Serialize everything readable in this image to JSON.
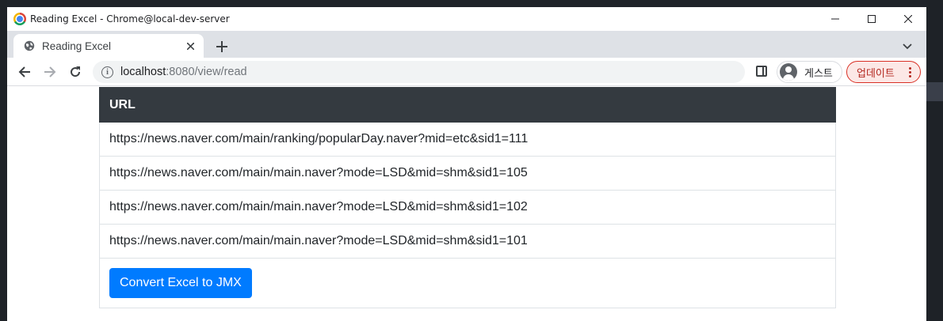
{
  "window": {
    "title": "Reading Excel - Chrome@local-dev-server"
  },
  "tabs": [
    {
      "label": "Reading Excel",
      "icon": "globe-icon"
    }
  ],
  "toolbar": {
    "url_host": "localhost",
    "url_path": ":8080/view/read",
    "profile_label": "게스트",
    "update_label": "업데이트"
  },
  "table": {
    "header": "URL",
    "rows": [
      "https://news.naver.com/main/ranking/popularDay.naver?mid=etc&sid1=111",
      "https://news.naver.com/main/main.naver?mode=LSD&mid=shm&sid1=105",
      "https://news.naver.com/main/main.naver?mode=LSD&mid=shm&sid1=102",
      "https://news.naver.com/main/main.naver?mode=LSD&mid=shm&sid1=101"
    ]
  },
  "actions": {
    "convert_label": "Convert Excel to JMX"
  },
  "colors": {
    "header_bg": "#343a40",
    "primary_button": "#007bff",
    "update_chip_border": "#d93025"
  }
}
